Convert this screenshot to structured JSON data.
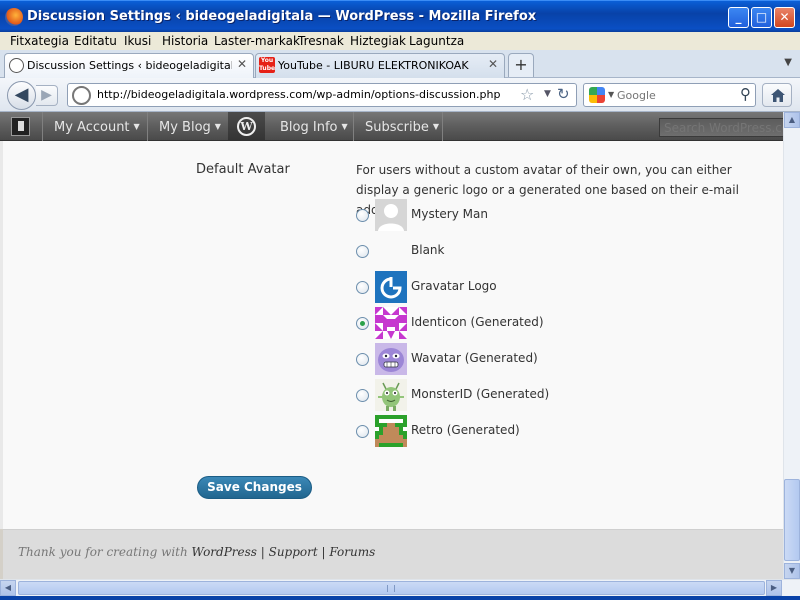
{
  "window": {
    "title": "Discussion Settings ‹ bideogeladigitala — WordPress - Mozilla Firefox",
    "controls": {
      "minimize": "_",
      "maximize": "□",
      "close": "✕"
    }
  },
  "menu": [
    "Fitxategia",
    "Editatu",
    "Ikusi",
    "Historia",
    "Laster-markak",
    "Tresnak",
    "Hiztegiak",
    "Laguntza"
  ],
  "tabs": [
    {
      "label": "Discussion Settings ‹ bideogeladigitala — ...",
      "active": true,
      "icon": "wordpress-icon",
      "close": "✕"
    },
    {
      "label": "YouTube - LIBURU ELEKTRONIKOAK",
      "active": false,
      "icon": "youtube-icon",
      "close": "✕"
    }
  ],
  "new_tab": "+",
  "tab_list": "▼",
  "youtube_icon_text": "You Tube",
  "nav": {
    "back": "◀",
    "forward": "▶",
    "url": "http://bideogeladigitala.wordpress.com/wp-admin/options-discussion.php",
    "bookmark": "☆",
    "dropdown": "▼",
    "reload": "↻",
    "search_placeholder": "Google",
    "search_drop": "▼",
    "search_go": "⚲"
  },
  "wpbar": {
    "items": [
      "My Account",
      "My Blog",
      "Blog Info",
      "Subscribe"
    ],
    "caret": "▼",
    "logo": "W",
    "search_placeholder": "Search WordPress.com"
  },
  "settings": {
    "default_avatar_label": "Default Avatar",
    "description": "For users without a custom avatar of their own, you can either display a generic logo or a generated one based on their e-mail address.",
    "avatars": [
      {
        "name": "Mystery Man",
        "checked": false
      },
      {
        "name": "Blank",
        "checked": false
      },
      {
        "name": "Gravatar Logo",
        "checked": false
      },
      {
        "name": "Identicon (Generated)",
        "checked": true
      },
      {
        "name": "Wavatar (Generated)",
        "checked": false
      },
      {
        "name": "MonsterID (Generated)",
        "checked": false
      },
      {
        "name": "Retro (Generated)",
        "checked": false
      }
    ],
    "save_label": "Save Changes"
  },
  "footer": {
    "prefix": "Thank you for creating with ",
    "wordpress": "WordPress",
    "sep1": " | ",
    "support": "Support",
    "sep2": " | ",
    "forums": "Forums"
  },
  "scrollbars": {
    "up": "▲",
    "down": "▼",
    "left": "◀",
    "right": "▶"
  },
  "colors": {
    "accent": "#21668f",
    "wpbar": "#5e5e5e",
    "titlebar": "#0a4fc4"
  }
}
